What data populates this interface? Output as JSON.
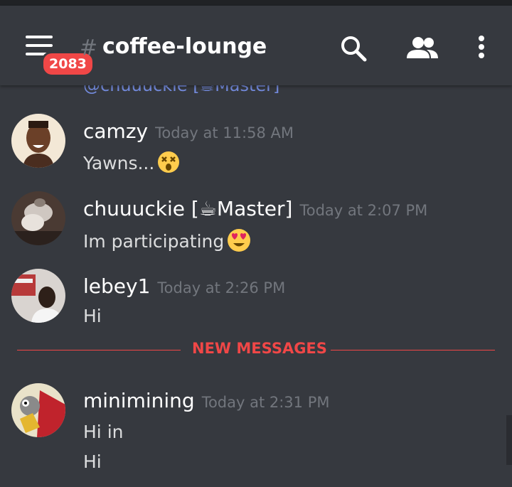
{
  "header": {
    "unread_badge": "2083",
    "hash_symbol": "#",
    "channel_name": "coffee-lounge"
  },
  "cutoff_text": "@chuuuckie [☕Master]",
  "messages": [
    {
      "author": "camzy",
      "timestamp": "Today at 11:58 AM",
      "lines": [
        "Yawns..."
      ],
      "emoji": "dizzy-face"
    },
    {
      "author": "chuuuckie [☕Master]",
      "timestamp": "Today at 2:07 PM",
      "lines": [
        "Im participating"
      ],
      "emoji": "heart-eyes"
    },
    {
      "author": "lebey1",
      "timestamp": "Today at 2:26 PM",
      "lines": [
        "Hi"
      ]
    },
    {
      "author": "minimining",
      "timestamp": "Today at 2:31 PM",
      "lines": [
        "Hi in",
        "Hi"
      ]
    }
  ],
  "divider_label": "NEW MESSAGES",
  "colors": {
    "background": "#36393f",
    "accent_red": "#f04747",
    "mention_blue": "#7289da",
    "timestamp_gray": "#72767d"
  }
}
